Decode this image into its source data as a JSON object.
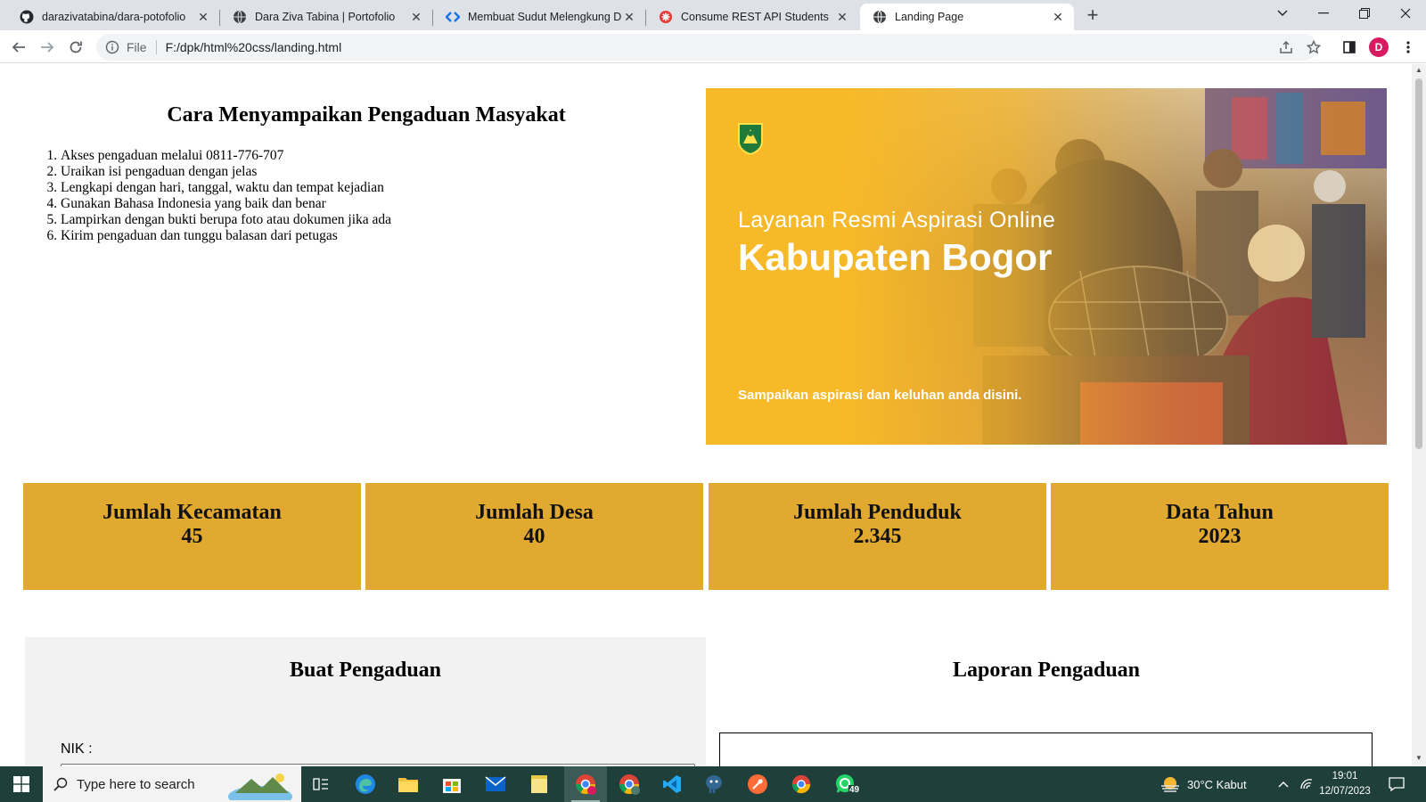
{
  "browser": {
    "tabs": [
      {
        "title": "darazivatabina/dara-potofolio",
        "icon": "github-icon"
      },
      {
        "title": "Dara Ziva Tabina | Portofolio",
        "icon": "globe-icon"
      },
      {
        "title": "Membuat Sudut Melengkung De",
        "icon": "code-icon"
      },
      {
        "title": "Consume REST API Students",
        "icon": "red-star-icon"
      },
      {
        "title": "Landing Page",
        "icon": "globe-icon",
        "active": true
      }
    ],
    "close_glyph": "✕",
    "new_tab_glyph": "+",
    "address": {
      "scheme": "File",
      "url": "F:/dpk/html%20css/landing.html"
    },
    "profile_initial": "D"
  },
  "page": {
    "how_to": {
      "title": "Cara Menyampaikan Pengaduan Masyakat",
      "steps": [
        "Akses pengaduan melalui 0811-776-707",
        "Uraikan isi pengaduan dengan jelas",
        "Lengkapi dengan hari, tanggal, waktu dan tempat kejadian",
        "Gunakan Bahasa Indonesia yang baik dan benar",
        "Lampirkan dengan bukti berupa foto atau dokumen jika ada",
        "Kirim pengaduan dan tunggu balasan dari petugas"
      ]
    },
    "banner": {
      "subtitle": "Layanan Resmi Aspirasi Online",
      "title": "Kabupaten Bogor",
      "tagline": "Sampaikan aspirasi dan keluhan anda disini.",
      "accent_color": "#f8b928"
    },
    "stats": [
      {
        "label": "Jumlah Kecamatan",
        "value": "45"
      },
      {
        "label": "Jumlah Desa",
        "value": "40"
      },
      {
        "label": "Jumlah Penduduk",
        "value": "2.345"
      },
      {
        "label": "Data Tahun",
        "value": "2023"
      }
    ],
    "stat_color": "#e1a92f",
    "form": {
      "title": "Buat Pengaduan",
      "nik_label": "NIK :",
      "nik_value": ""
    },
    "report": {
      "title": "Laporan Pengaduan"
    }
  },
  "taskbar": {
    "search_placeholder": "Type here to search",
    "weather": "30°C  Kabut",
    "time": "19:01",
    "date": "12/07/2023",
    "whatsapp_badge": "49"
  }
}
